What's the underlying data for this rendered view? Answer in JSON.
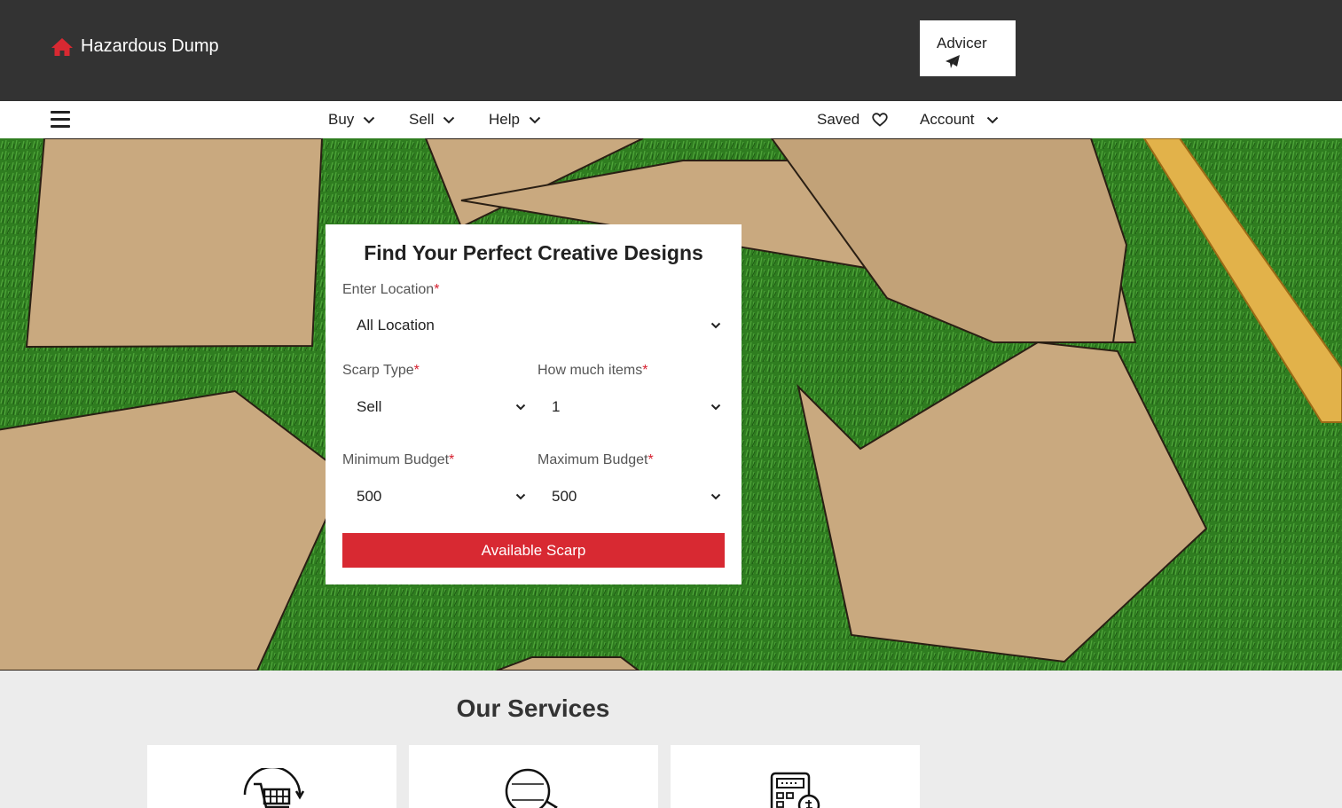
{
  "header": {
    "brand_name": "Hazardous Dump",
    "brand_icon": "home-icon",
    "advicer_label": "Advicer",
    "advicer_icon": "paper-plane-icon"
  },
  "nav": {
    "menu_icon": "hamburger-icon",
    "items": [
      {
        "label": "Buy",
        "icon": "chevron-down-icon"
      },
      {
        "label": "Sell",
        "icon": "chevron-down-icon"
      },
      {
        "label": "Help",
        "icon": "chevron-down-icon"
      }
    ],
    "saved_label": "Saved",
    "saved_icon": "heart-icon",
    "account_label": "Account",
    "account_icon": "chevron-down-icon"
  },
  "search": {
    "title": "Find Your Perfect Creative Designs",
    "location_label": "Enter Location",
    "location_value": "All Location",
    "scrap_type_label": "Scarp Type",
    "scrap_type_value": "Sell",
    "items_label": "How much items",
    "items_value": "1",
    "min_budget_label": "Minimum Budget",
    "min_budget_value": "500",
    "max_budget_label": "Maximum Budget",
    "max_budget_value": "500",
    "required_mark": "*",
    "submit_label": "Available Scarp"
  },
  "services": {
    "title": "Our Services",
    "cards": [
      {
        "icon": "cart-recycle-icon"
      },
      {
        "icon": "sell-tag-icon"
      },
      {
        "icon": "calculator-icon"
      }
    ]
  },
  "colors": {
    "header_bg": "#333333",
    "accent_red": "#d82932",
    "page_bg": "#ececec"
  }
}
